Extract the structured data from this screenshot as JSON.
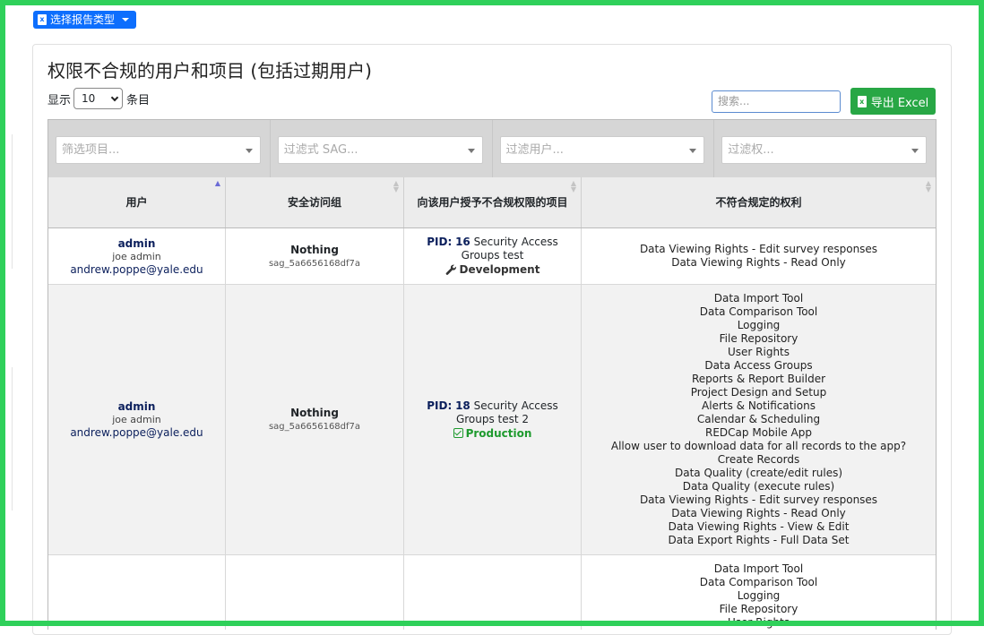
{
  "toolbar": {
    "report_type_label": "选择报告类型"
  },
  "page": {
    "title": "权限不合规的用户和项目 (包括过期用户)"
  },
  "length_menu": {
    "show_label": "显示",
    "value": "10",
    "entries_label": "条目"
  },
  "search": {
    "placeholder": "搜索..."
  },
  "export": {
    "label": "导出 Excel"
  },
  "filters": [
    {
      "placeholder": "筛选项目..."
    },
    {
      "placeholder": "过滤式 SAG..."
    },
    {
      "placeholder": "过滤用户..."
    },
    {
      "placeholder": "过滤权..."
    }
  ],
  "columns": [
    {
      "label": "用户",
      "sorted": "asc"
    },
    {
      "label": "安全访问组",
      "sorted": "none"
    },
    {
      "label": "向该用户授予不合规权限的项目",
      "sorted": "none"
    },
    {
      "label": "不符合规定的权利",
      "sorted": "none"
    }
  ],
  "rows": [
    {
      "user": {
        "username": "admin",
        "fullname": "joe admin",
        "email": "andrew.poppe@yale.edu"
      },
      "sag": {
        "name": "Nothing",
        "id": "sag_5a6656168df7a"
      },
      "project": {
        "pid_label": "PID:",
        "pid": "16",
        "name": "Security Access Groups test",
        "status": "Development",
        "status_type": "dev"
      },
      "rights": [
        "Data Viewing Rights - Edit survey responses",
        "Data Viewing Rights - Read Only"
      ]
    },
    {
      "user": {
        "username": "admin",
        "fullname": "joe admin",
        "email": "andrew.poppe@yale.edu"
      },
      "sag": {
        "name": "Nothing",
        "id": "sag_5a6656168df7a"
      },
      "project": {
        "pid_label": "PID:",
        "pid": "18",
        "name": "Security Access Groups test 2",
        "status": "Production",
        "status_type": "prod"
      },
      "rights": [
        "Data Import Tool",
        "Data Comparison Tool",
        "Logging",
        "File Repository",
        "User Rights",
        "Data Access Groups",
        "Reports & Report Builder",
        "Project Design and Setup",
        "Alerts & Notifications",
        "Calendar & Scheduling",
        "REDCap Mobile App",
        "Allow user to download data for all records to the app?",
        "Create Records",
        "Data Quality (create/edit rules)",
        "Data Quality (execute rules)",
        "Data Viewing Rights - Edit survey responses",
        "Data Viewing Rights - Read Only",
        "Data Viewing Rights - View & Edit",
        "Data Export Rights - Full Data Set"
      ]
    },
    {
      "user": {
        "username": "",
        "fullname": "",
        "email": ""
      },
      "sag": {
        "name": "",
        "id": ""
      },
      "project": {
        "pid_label": "",
        "pid": "",
        "name": "",
        "status": "",
        "status_type": ""
      },
      "rights": [
        "Data Import Tool",
        "Data Comparison Tool",
        "Logging",
        "File Repository",
        "User Rights"
      ]
    }
  ]
}
